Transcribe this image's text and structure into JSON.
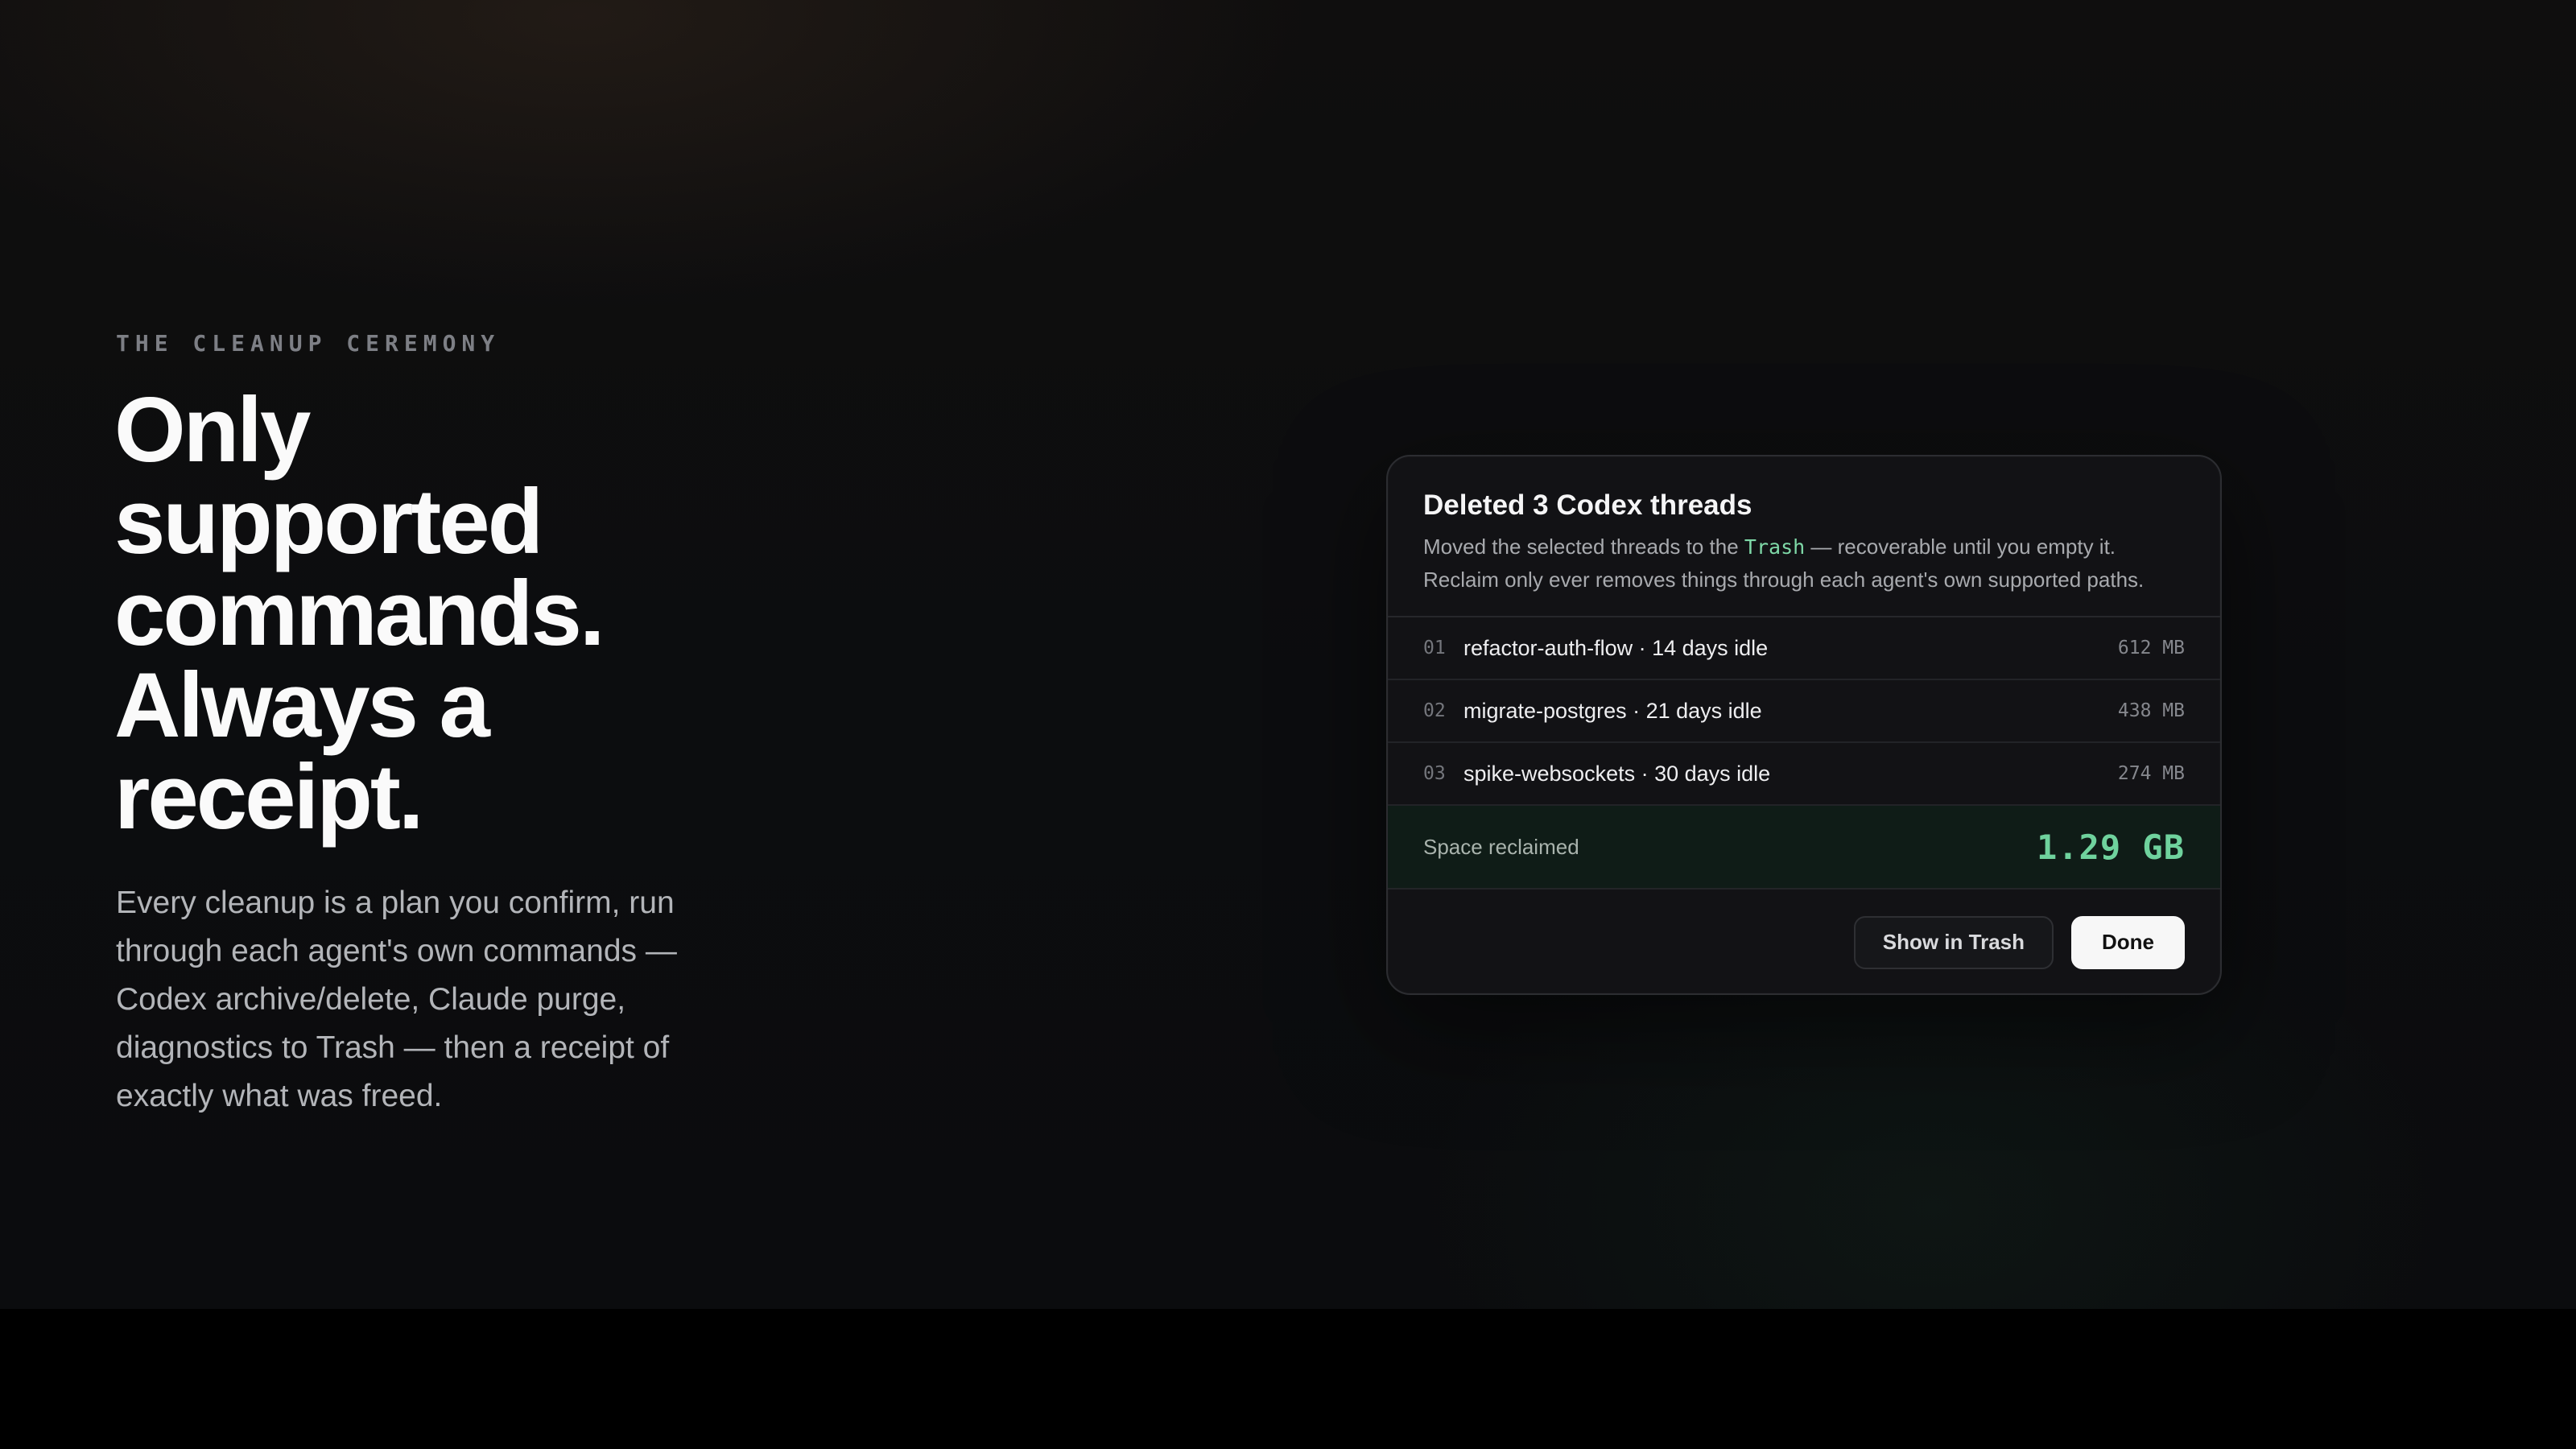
{
  "hero": {
    "eyebrow": "THE CLEANUP CEREMONY",
    "headline": "Only supported commands. Always a receipt.",
    "body": "Every cleanup is a plan you confirm, run through each agent's own commands — Codex archive/delete, Claude purge, diagnostics to Trash — then a receipt of exactly what was freed."
  },
  "receipt": {
    "title": "Deleted 3 Codex threads",
    "desc_line1_before": "Moved the selected threads to the ",
    "desc_code": "Trash",
    "desc_line1_after": " — recoverable until you empty it.",
    "desc_line2": "Reclaim only ever removes things through each agent's own supported paths.",
    "rows": [
      {
        "index": "01",
        "name": "refactor-auth-flow · 14 days idle",
        "size": "612 MB"
      },
      {
        "index": "02",
        "name": "migrate-postgres · 21 days idle",
        "size": "438 MB"
      },
      {
        "index": "03",
        "name": "spike-websockets · 30 days idle",
        "size": "274 MB"
      }
    ],
    "total_label": "Space reclaimed",
    "total_value": "1.29 GB",
    "actions": {
      "secondary": "Show in Trash",
      "primary": "Done"
    }
  },
  "colors": {
    "accent_green": "#6fd29d",
    "code_green": "#7fd9a8",
    "card_bg": "#121215",
    "total_bg": "#0f1c17"
  }
}
